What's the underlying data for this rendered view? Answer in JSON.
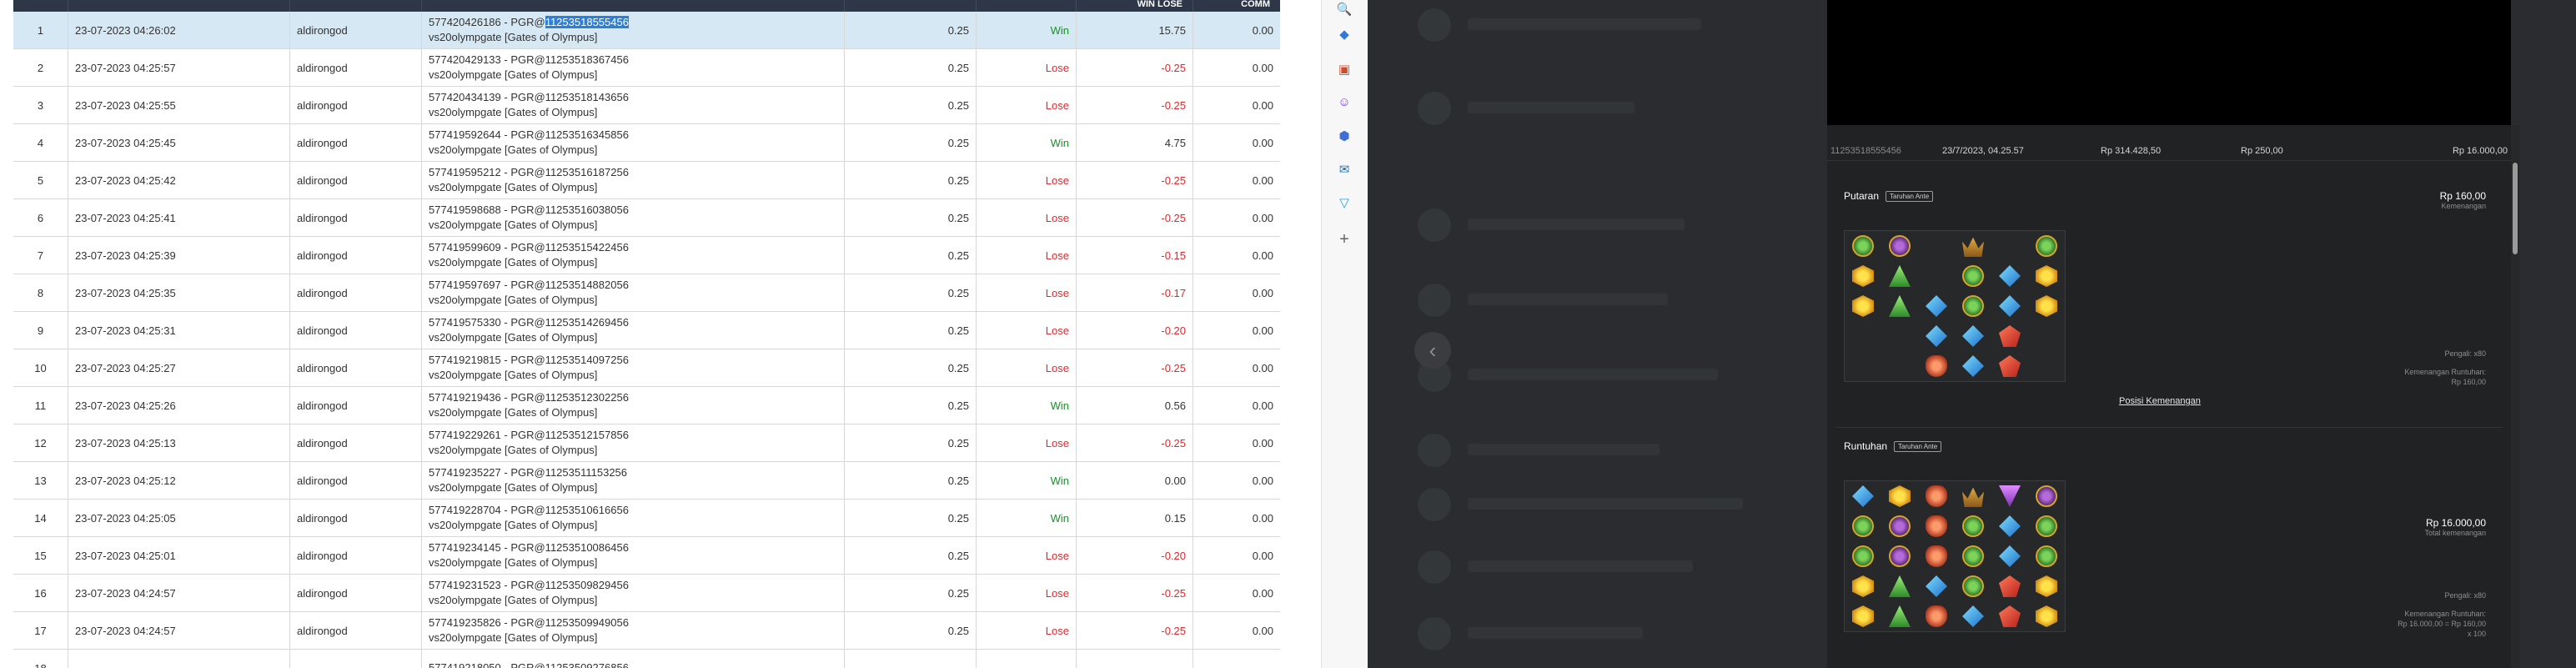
{
  "table": {
    "headers": [
      "",
      "",
      "",
      "",
      "",
      "",
      "WIN LOSE",
      "COMM"
    ],
    "rows": [
      {
        "no": "1",
        "date": "23-07-2023 04:26:02",
        "user": "aldirongod",
        "desc_prefix": "577420426186 - PGR@",
        "desc_hl": "11253518555456",
        "game": "vs20olympgate [Gates of Olympus]",
        "bet": "0.25",
        "result": "Win",
        "winlose": "15.75",
        "comm": "0.00",
        "selected": true
      },
      {
        "no": "2",
        "date": "23-07-2023 04:25:57",
        "user": "aldirongod",
        "desc_prefix": "577420429133 - PGR@11253518367456",
        "desc_hl": "",
        "game": "vs20olympgate [Gates of Olympus]",
        "bet": "0.25",
        "result": "Lose",
        "winlose": "-0.25",
        "comm": "0.00"
      },
      {
        "no": "3",
        "date": "23-07-2023 04:25:55",
        "user": "aldirongod",
        "desc_prefix": "577420434139 - PGR@11253518143656",
        "desc_hl": "",
        "game": "vs20olympgate [Gates of Olympus]",
        "bet": "0.25",
        "result": "Lose",
        "winlose": "-0.25",
        "comm": "0.00"
      },
      {
        "no": "4",
        "date": "23-07-2023 04:25:45",
        "user": "aldirongod",
        "desc_prefix": "577419592644 - PGR@11253516345856",
        "desc_hl": "",
        "game": "vs20olympgate [Gates of Olympus]",
        "bet": "0.25",
        "result": "Win",
        "winlose": "4.75",
        "comm": "0.00"
      },
      {
        "no": "5",
        "date": "23-07-2023 04:25:42",
        "user": "aldirongod",
        "desc_prefix": "577419595212 - PGR@11253516187256",
        "desc_hl": "",
        "game": "vs20olympgate [Gates of Olympus]",
        "bet": "0.25",
        "result": "Lose",
        "winlose": "-0.25",
        "comm": "0.00"
      },
      {
        "no": "6",
        "date": "23-07-2023 04:25:41",
        "user": "aldirongod",
        "desc_prefix": "577419598688 - PGR@11253516038056",
        "desc_hl": "",
        "game": "vs20olympgate [Gates of Olympus]",
        "bet": "0.25",
        "result": "Lose",
        "winlose": "-0.25",
        "comm": "0.00"
      },
      {
        "no": "7",
        "date": "23-07-2023 04:25:39",
        "user": "aldirongod",
        "desc_prefix": "577419599609 - PGR@11253515422456",
        "desc_hl": "",
        "game": "vs20olympgate [Gates of Olympus]",
        "bet": "0.25",
        "result": "Lose",
        "winlose": "-0.15",
        "comm": "0.00"
      },
      {
        "no": "8",
        "date": "23-07-2023 04:25:35",
        "user": "aldirongod",
        "desc_prefix": "577419597697 - PGR@11253514882056",
        "desc_hl": "",
        "game": "vs20olympgate [Gates of Olympus]",
        "bet": "0.25",
        "result": "Lose",
        "winlose": "-0.17",
        "comm": "0.00"
      },
      {
        "no": "9",
        "date": "23-07-2023 04:25:31",
        "user": "aldirongod",
        "desc_prefix": "577419575330 - PGR@11253514269456",
        "desc_hl": "",
        "game": "vs20olympgate [Gates of Olympus]",
        "bet": "0.25",
        "result": "Lose",
        "winlose": "-0.20",
        "comm": "0.00"
      },
      {
        "no": "10",
        "date": "23-07-2023 04:25:27",
        "user": "aldirongod",
        "desc_prefix": "577419219815 - PGR@11253514097256",
        "desc_hl": "",
        "game": "vs20olympgate [Gates of Olympus]",
        "bet": "0.25",
        "result": "Lose",
        "winlose": "-0.25",
        "comm": "0.00"
      },
      {
        "no": "11",
        "date": "23-07-2023 04:25:26",
        "user": "aldirongod",
        "desc_prefix": "577419219436 - PGR@11253512302256",
        "desc_hl": "",
        "game": "vs20olympgate [Gates of Olympus]",
        "bet": "0.25",
        "result": "Win",
        "winlose": "0.56",
        "comm": "0.00"
      },
      {
        "no": "12",
        "date": "23-07-2023 04:25:13",
        "user": "aldirongod",
        "desc_prefix": "577419229261 - PGR@11253512157856",
        "desc_hl": "",
        "game": "vs20olympgate [Gates of Olympus]",
        "bet": "0.25",
        "result": "Lose",
        "winlose": "-0.25",
        "comm": "0.00"
      },
      {
        "no": "13",
        "date": "23-07-2023 04:25:12",
        "user": "aldirongod",
        "desc_prefix": "577419235227 - PGR@11253511153256",
        "desc_hl": "",
        "game": "vs20olympgate [Gates of Olympus]",
        "bet": "0.25",
        "result": "Win",
        "winlose": "0.00",
        "comm": "0.00"
      },
      {
        "no": "14",
        "date": "23-07-2023 04:25:05",
        "user": "aldirongod",
        "desc_prefix": "577419228704 - PGR@11253510616656",
        "desc_hl": "",
        "game": "vs20olympgate [Gates of Olympus]",
        "bet": "0.25",
        "result": "Win",
        "winlose": "0.15",
        "comm": "0.00"
      },
      {
        "no": "15",
        "date": "23-07-2023 04:25:01",
        "user": "aldirongod",
        "desc_prefix": "577419234145 - PGR@11253510086456",
        "desc_hl": "",
        "game": "vs20olympgate [Gates of Olympus]",
        "bet": "0.25",
        "result": "Lose",
        "winlose": "-0.20",
        "comm": "0.00"
      },
      {
        "no": "16",
        "date": "23-07-2023 04:24:57",
        "user": "aldirongod",
        "desc_prefix": "577419231523 - PGR@11253509829456",
        "desc_hl": "",
        "game": "vs20olympgate [Gates of Olympus]",
        "bet": "0.25",
        "result": "Lose",
        "winlose": "-0.25",
        "comm": "0.00"
      },
      {
        "no": "17",
        "date": "23-07-2023 04:24:57",
        "user": "aldirongod",
        "desc_prefix": "577419235826 - PGR@11253509949056",
        "desc_hl": "",
        "game": "vs20olympgate [Gates of Olympus]",
        "bet": "0.25",
        "result": "Lose",
        "winlose": "-0.25",
        "comm": "0.00"
      },
      {
        "no": "18",
        "date": "",
        "user": "",
        "desc_prefix": "577419218050 - PGR@11253509276856",
        "desc_hl": "",
        "game": "",
        "bet": "",
        "result": "",
        "winlose": "",
        "comm": ""
      }
    ]
  },
  "sidebar": {
    "icons": [
      "search-icon",
      "tag-icon",
      "toolbox-icon",
      "people-icon",
      "office-icon",
      "outlook-icon",
      "shopping-cart-icon",
      "plus-icon"
    ]
  },
  "colors": {
    "win": "#1a8f2c",
    "lose": "#e0282e",
    "header_bg": "#2d3748",
    "selected_row": "#d5e8f3",
    "dark_bg": "#202224"
  },
  "round": {
    "summary": {
      "round_id": "11253518555456",
      "datetime": "23/7/2023, 04.25.57",
      "balance": "Rp 314.428,50",
      "bet": "Rp 250,00",
      "win": "Rp 16.000,00"
    },
    "spin": {
      "title": "Putaran",
      "badge": "Taruhan Ante",
      "amount": "Rp 160,00",
      "amount_label": "Kemenangan",
      "multiplier": "Pengali: x80",
      "tumble_label": "Kemenangan Runtuhan:",
      "tumble_value": "Rp 160,00",
      "link": "Posisi Kemenangan",
      "grid": [
        [
          "green",
          "purple",
          "",
          "crown",
          "",
          "green"
        ],
        [
          "yellow",
          "tri",
          "",
          "green",
          "blue",
          "yellow"
        ],
        [
          "yellow",
          "tri",
          "blue",
          "green",
          "blue",
          "yellow"
        ],
        [
          "",
          "",
          "blue",
          "blue",
          "red",
          ""
        ],
        [
          "",
          "",
          "amber",
          "blue",
          "red",
          ""
        ]
      ]
    },
    "tumble": {
      "title": "Runtuhan",
      "badge": "Taruhan Ante",
      "amount": "Rp 16.000,00",
      "amount_label": "Total kemenangan",
      "multiplier": "Pengali: x80",
      "tumble_label": "Kemenangan Runtuhan:",
      "tumble_value": "Rp 16.000,00 = Rp 160,00",
      "tumble_mult": "x 100",
      "grid": [
        [
          "blue",
          "yellow",
          "amber",
          "crown",
          "vio",
          "purple"
        ],
        [
          "green",
          "purple",
          "amber",
          "green",
          "blue",
          "green"
        ],
        [
          "green",
          "purple",
          "amber",
          "green",
          "blue",
          "green"
        ],
        [
          "yellow",
          "tri",
          "blue",
          "green",
          "red",
          "yellow"
        ],
        [
          "yellow",
          "tri",
          "amber",
          "blue",
          "red",
          "yellow"
        ]
      ]
    }
  }
}
